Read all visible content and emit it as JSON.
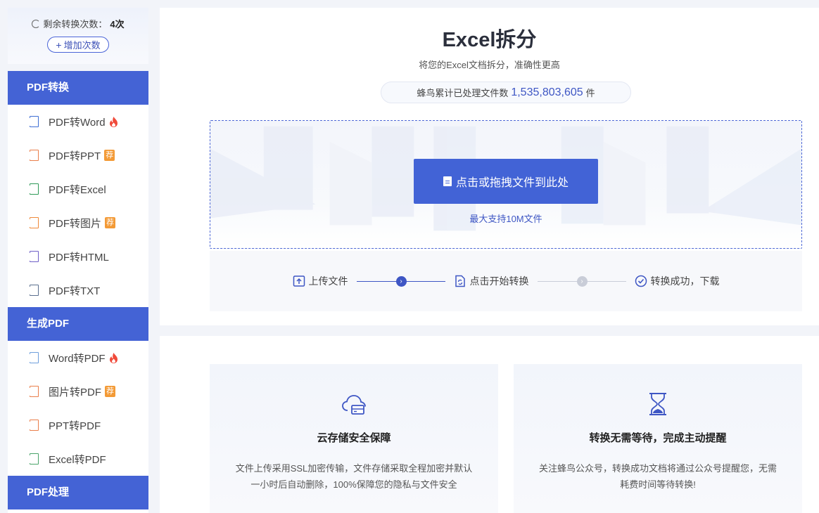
{
  "sidebar": {
    "quota_label": "剩余转换次数：",
    "quota_value": "4次",
    "add_button": "增加次数",
    "sections": [
      {
        "title": "PDF转换",
        "items": [
          {
            "label": "PDF转Word",
            "icon": "word-file-icon",
            "badge": "hot"
          },
          {
            "label": "PDF转PPT",
            "icon": "ppt-file-icon",
            "badge": "荐"
          },
          {
            "label": "PDF转Excel",
            "icon": "excel-file-icon",
            "badge": ""
          },
          {
            "label": "PDF转图片",
            "icon": "image-file-icon",
            "badge": "荐"
          },
          {
            "label": "PDF转HTML",
            "icon": "html-file-icon",
            "badge": ""
          },
          {
            "label": "PDF转TXT",
            "icon": "txt-file-icon",
            "badge": ""
          }
        ]
      },
      {
        "title": "生成PDF",
        "items": [
          {
            "label": "Word转PDF",
            "icon": "pdf-word-icon",
            "badge": "hot"
          },
          {
            "label": "图片转PDF",
            "icon": "pdf-image-icon",
            "badge": "荐"
          },
          {
            "label": "PPT转PDF",
            "icon": "pdf-ppt-icon",
            "badge": ""
          },
          {
            "label": "Excel转PDF",
            "icon": "pdf-excel-icon",
            "badge": ""
          }
        ]
      },
      {
        "title": "PDF处理",
        "items": []
      }
    ]
  },
  "main": {
    "title": "Excel拆分",
    "subtitle": "将您的Excel文档拆分，准确性更高",
    "counter_prefix": "蜂鸟累计已处理文件数",
    "counter_value": "1,535,803,605",
    "counter_suffix": "件",
    "upload_button": "点击或拖拽文件到此处",
    "limit": "最大支持10M文件",
    "steps": [
      "上传文件",
      "点击开始转换",
      "转换成功，下载"
    ]
  },
  "features": [
    {
      "icon": "cloud-storage-icon",
      "title": "云存储安全保障",
      "text": "文件上传采用SSL加密传输，文件存储采取全程加密并默认一小时后自动删除，100%保障您的隐私与文件安全"
    },
    {
      "icon": "hourglass-icon",
      "title": "转换无需等待，完成主动提醒",
      "text": "关注蜂鸟公众号，转换成功文档将通过公众号提醒您，无需耗费时间等待转换!"
    }
  ],
  "colors": {
    "accent": "#4463d5",
    "badge": "#f39a36",
    "hot": "#f04a3a"
  }
}
